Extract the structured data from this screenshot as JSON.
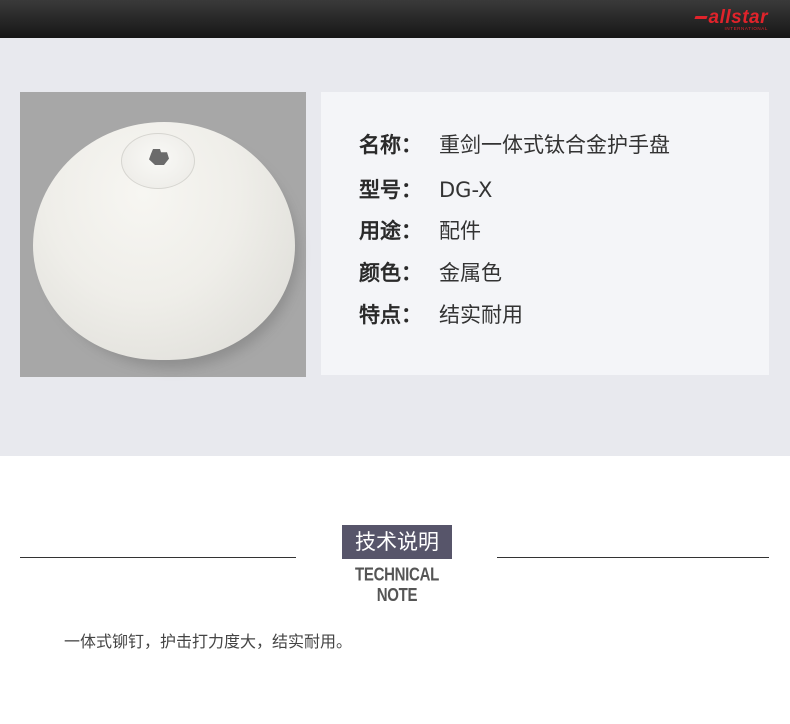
{
  "header": {
    "brand": "allstar",
    "brand_sub": "INTERNATIONAL",
    "brand_color": "#e0232b"
  },
  "product": {
    "specs": [
      {
        "label": "名称：",
        "value": "重剑一体式钛合金护手盘"
      },
      {
        "label": "型号：",
        "value": "DG-X"
      },
      {
        "label": "用途：",
        "value": "配件"
      },
      {
        "label": "颜色：",
        "value": "金属色"
      },
      {
        "label": "特点：",
        "value": "结实耐用"
      }
    ]
  },
  "technical": {
    "title": "技术说明",
    "subtitle": "TECHNICAL NOTE",
    "title_bg": "#57556a",
    "description": "一体式铆钉，护击打力度大，结实耐用。"
  }
}
